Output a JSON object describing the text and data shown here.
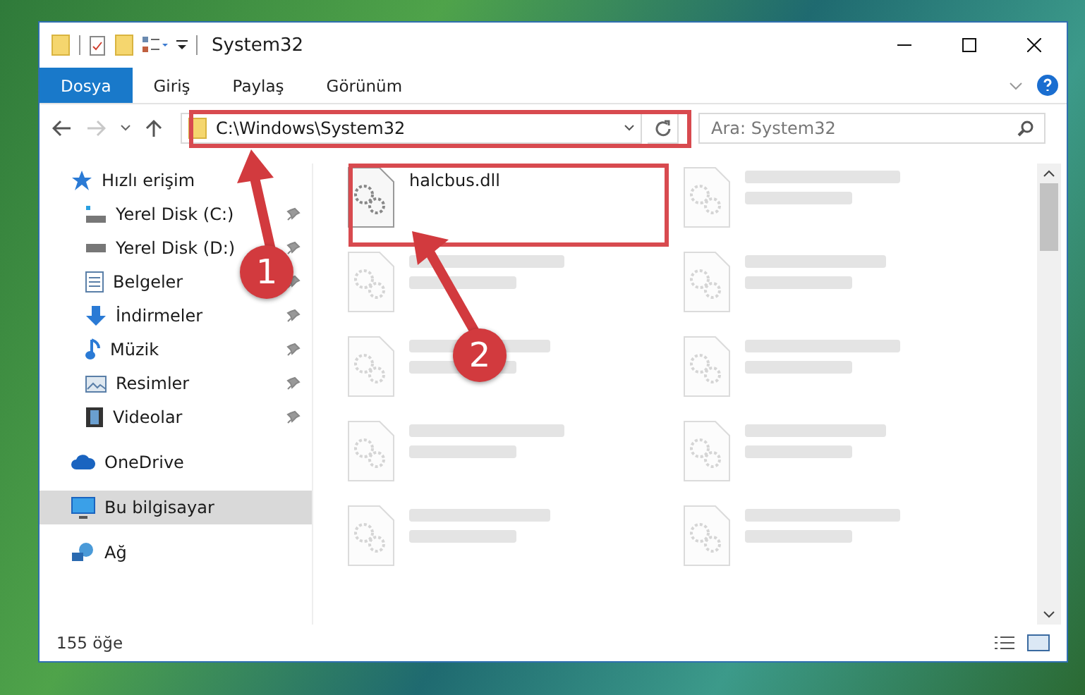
{
  "window": {
    "title": "System32"
  },
  "ribbon_tabs": [
    {
      "label": "Dosya",
      "selected": true
    },
    {
      "label": "Giriş",
      "selected": false
    },
    {
      "label": "Paylaş",
      "selected": false
    },
    {
      "label": "Görünüm",
      "selected": false
    }
  ],
  "address": {
    "value": "C:\\Windows\\System32"
  },
  "search": {
    "placeholder": "Ara: System32"
  },
  "sidebar": {
    "items": [
      {
        "label": "Hızlı erişim",
        "kind": "star",
        "selected": false,
        "children": [
          {
            "label": "Yerel Disk (C:)",
            "kind": "drive-c",
            "pinned": true
          },
          {
            "label": "Yerel Disk (D:)",
            "kind": "drive",
            "pinned": true
          },
          {
            "label": "Belgeler",
            "kind": "docs",
            "pinned": true
          },
          {
            "label": "İndirmeler",
            "kind": "download",
            "pinned": true
          },
          {
            "label": "Müzik",
            "kind": "music",
            "pinned": true
          },
          {
            "label": "Resimler",
            "kind": "pictures",
            "pinned": true
          },
          {
            "label": "Videolar",
            "kind": "videos",
            "pinned": true
          }
        ]
      },
      {
        "label": "OneDrive",
        "kind": "cloud",
        "selected": false
      },
      {
        "label": "Bu bilgisayar",
        "kind": "pc",
        "selected": true
      },
      {
        "label": "Ağ",
        "kind": "network",
        "selected": false
      }
    ]
  },
  "files": [
    {
      "kind": "file",
      "name": "halcbus.dll"
    },
    {
      "kind": "blurred"
    },
    {
      "kind": "blurred"
    },
    {
      "kind": "blurred"
    },
    {
      "kind": "blurred"
    },
    {
      "kind": "blurred"
    },
    {
      "kind": "blurred"
    },
    {
      "kind": "blurred"
    },
    {
      "kind": "blurred"
    },
    {
      "kind": "blurred"
    }
  ],
  "status_bar": {
    "count": "155 öğe"
  },
  "annotations": [
    {
      "label": "1"
    },
    {
      "label": "2"
    }
  ]
}
